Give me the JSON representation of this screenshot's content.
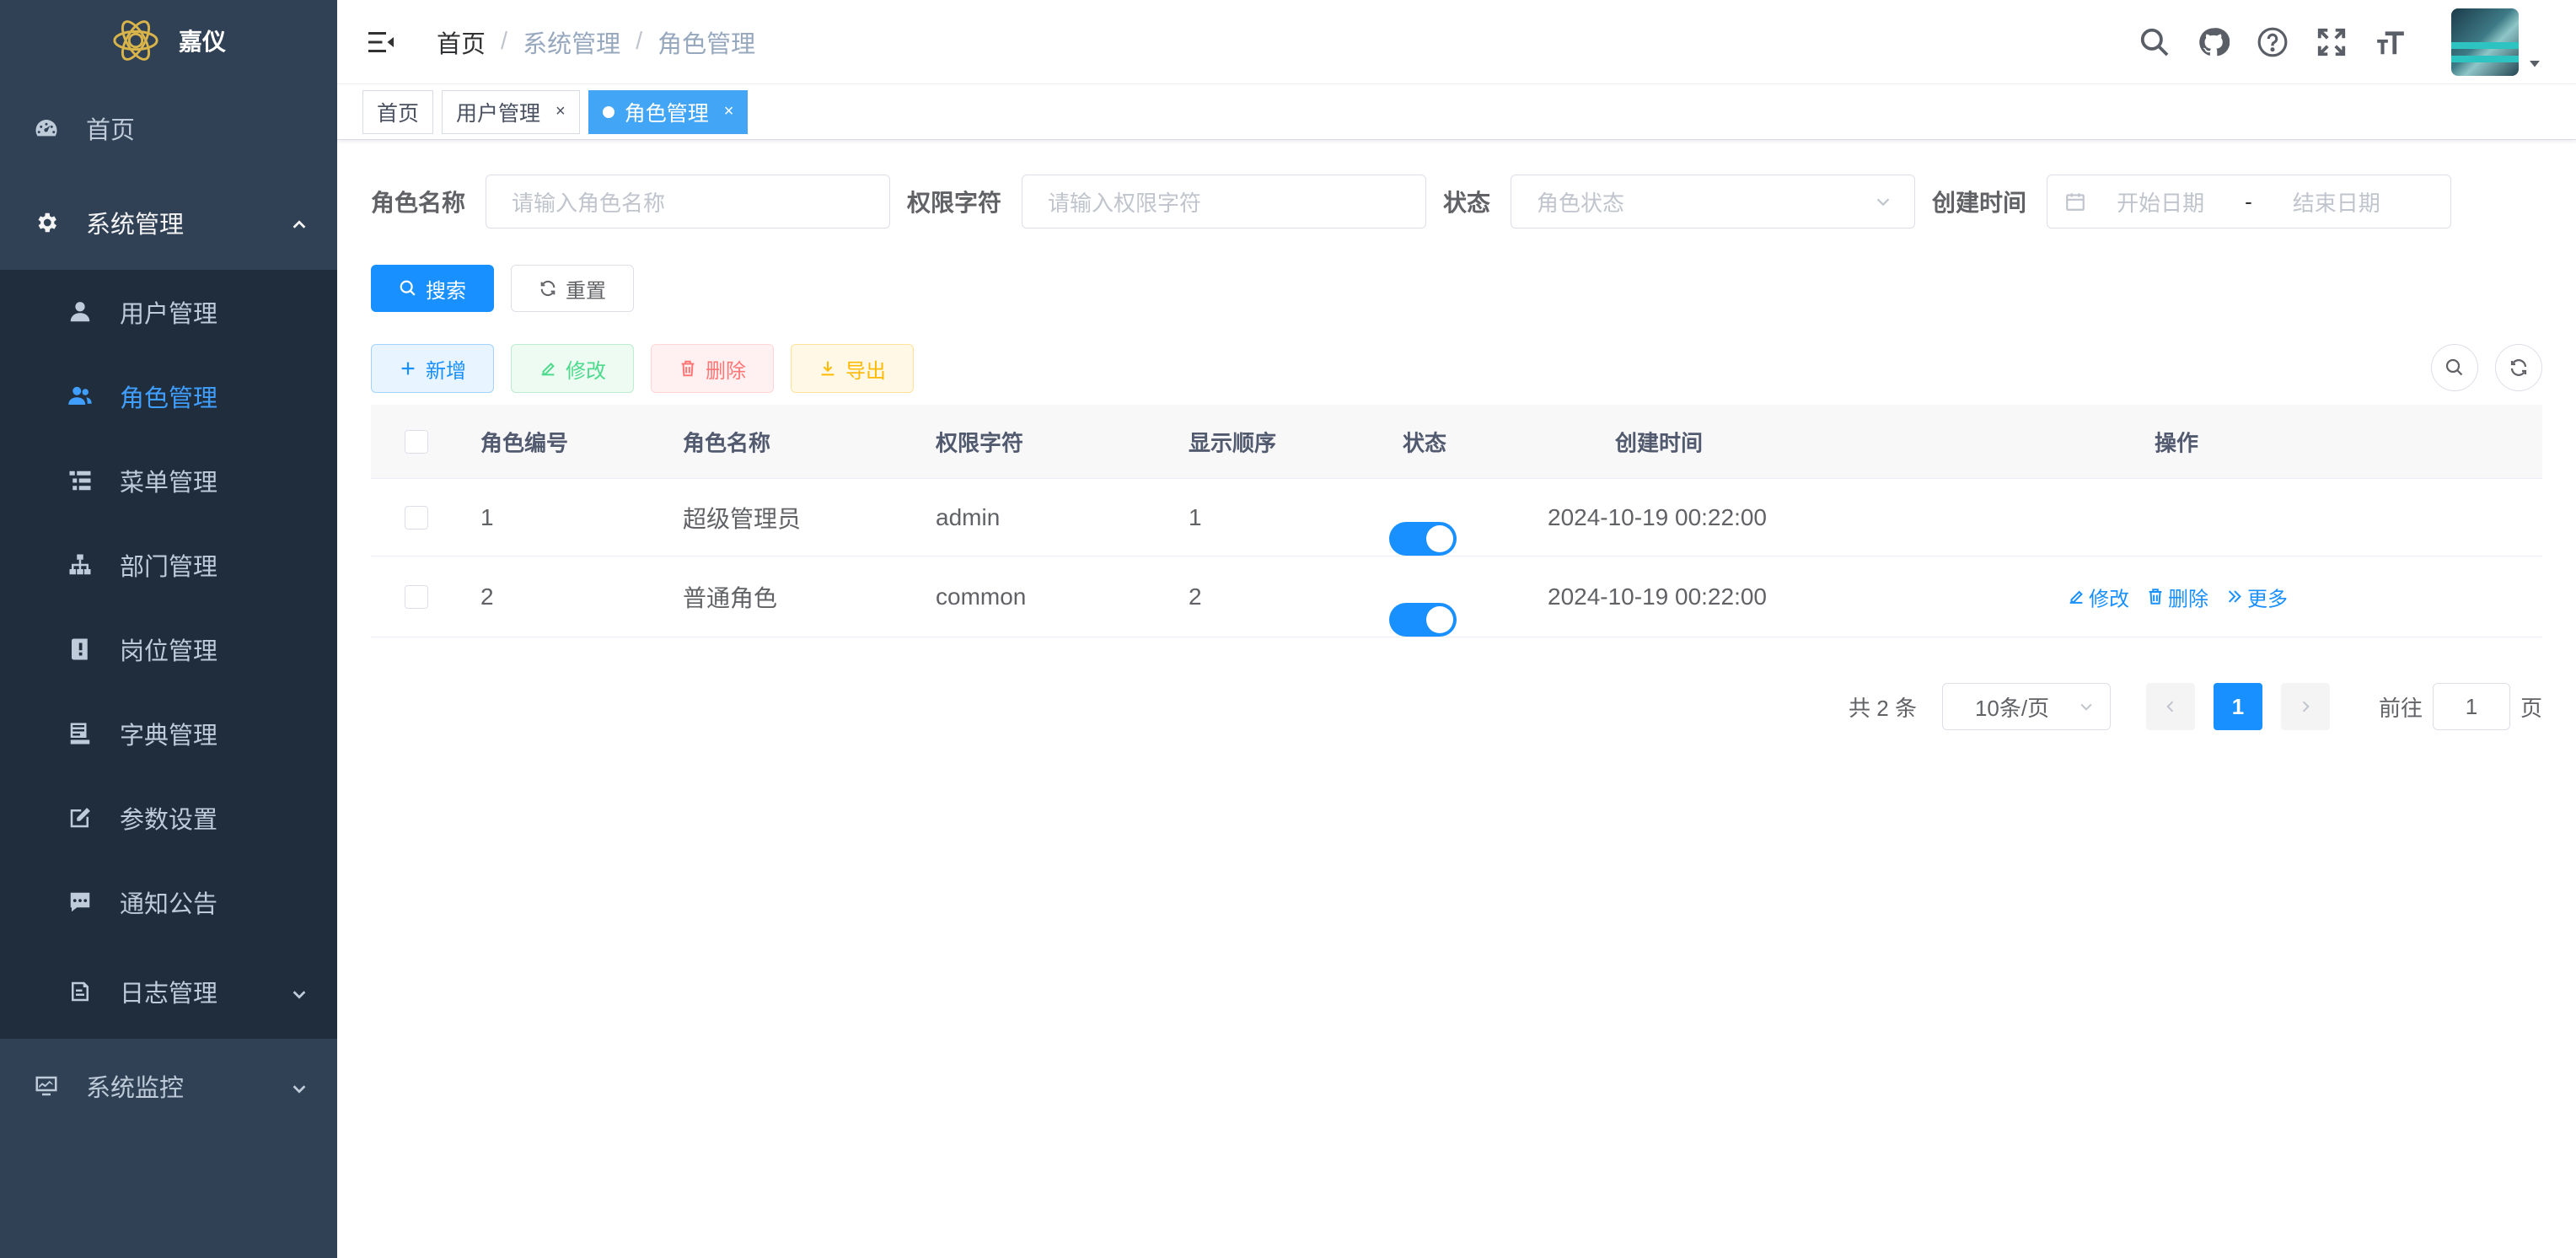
{
  "sidebar": {
    "brand": "嘉仪",
    "home": "首页",
    "system": "系统管理",
    "items": [
      {
        "label": "用户管理"
      },
      {
        "label": "角色管理"
      },
      {
        "label": "菜单管理"
      },
      {
        "label": "部门管理"
      },
      {
        "label": "岗位管理"
      },
      {
        "label": "字典管理"
      },
      {
        "label": "参数设置"
      },
      {
        "label": "通知公告"
      },
      {
        "label": "日志管理"
      }
    ],
    "monitor": "系统监控"
  },
  "breadcrumb": [
    "首页",
    "系统管理",
    "角色管理"
  ],
  "tags": [
    {
      "label": "首页"
    },
    {
      "label": "用户管理",
      "close": "×"
    },
    {
      "label": "角色管理",
      "close": "×"
    }
  ],
  "filters": {
    "role_name_label": "角色名称",
    "role_name_placeholder": "请输入角色名称",
    "perm_label": "权限字符",
    "perm_placeholder": "请输入权限字符",
    "status_label": "状态",
    "status_placeholder": "角色状态",
    "time_label": "创建时间",
    "start_placeholder": "开始日期",
    "range_sep": "-",
    "end_placeholder": "结束日期"
  },
  "buttons": {
    "search": "搜索",
    "reset": "重置",
    "add": "新增",
    "edit": "修改",
    "delete": "删除",
    "export": "导出"
  },
  "table": {
    "headers": [
      "角色编号",
      "角色名称",
      "权限字符",
      "显示顺序",
      "状态",
      "创建时间",
      "操作"
    ],
    "rows": [
      {
        "id": "1",
        "name": "超级管理员",
        "key": "admin",
        "order": "1",
        "enabled": true,
        "created": "2024-10-19 00:22:00",
        "ops": []
      },
      {
        "id": "2",
        "name": "普通角色",
        "key": "common",
        "order": "2",
        "enabled": true,
        "created": "2024-10-19 00:22:00",
        "ops": [
          "修改",
          "删除",
          "更多"
        ]
      }
    ]
  },
  "pagination": {
    "total": "共 2 条",
    "page_size": "10条/页",
    "current": "1",
    "goto_label": "前往",
    "goto_value": "1",
    "page_suffix": "页"
  },
  "colors": {
    "sidebar_bg": "#304156",
    "submenu_bg": "#1f2d3d",
    "primary": "#1890ff",
    "active_tag": "#42a5f5"
  }
}
